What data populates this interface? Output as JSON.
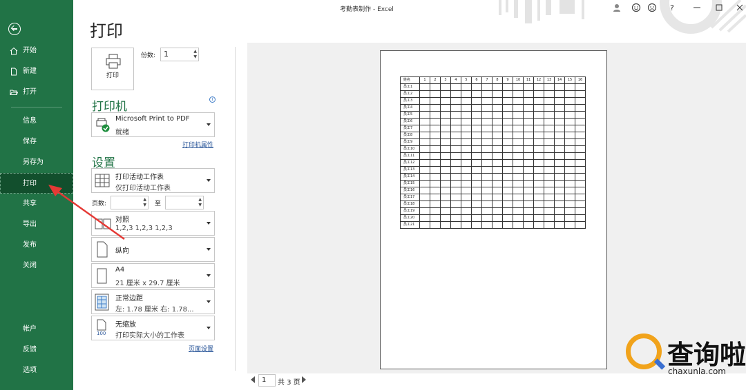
{
  "window": {
    "title": "考勤表制作  -  Excel"
  },
  "sidebar": {
    "items": [
      {
        "label": "开始",
        "icon": "home-icon"
      },
      {
        "label": "新建",
        "icon": "new-doc-icon"
      },
      {
        "label": "打开",
        "icon": "folder-open-icon"
      },
      {
        "label": "信息"
      },
      {
        "label": "保存"
      },
      {
        "label": "另存为"
      },
      {
        "label": "打印",
        "active": true
      },
      {
        "label": "共享"
      },
      {
        "label": "导出"
      },
      {
        "label": "发布"
      },
      {
        "label": "关闭"
      },
      {
        "label": "帐户"
      },
      {
        "label": "反馈"
      },
      {
        "label": "选项"
      }
    ]
  },
  "print": {
    "title": "打印",
    "button_label": "打印",
    "copies_label": "份数:",
    "copies_value": "1",
    "printer_section": "打印机",
    "printer_name": "Microsoft Print to PDF",
    "printer_status": "就绪",
    "printer_props_link": "打印机属性",
    "settings_section": "设置",
    "scope_title": "打印活动工作表",
    "scope_sub": "仅打印活动工作表",
    "pages_label": "页数:",
    "pages_to_label": "至",
    "collate_title": "对照",
    "collate_sub": "1,2,3    1,2,3    1,2,3",
    "orientation": "纵向",
    "paper_title": "A4",
    "paper_sub": "21 厘米 x 29.7 厘米",
    "margins_title": "正常边距",
    "margins_sub": "左: 1.78 厘米    右: 1.78...",
    "scaling_title": "无缩放",
    "scaling_sub": "打印实际大小的工作表",
    "scaling_icon_text": "100",
    "page_setup_link": "页面设置"
  },
  "preview": {
    "header_name": "姓名",
    "day_columns": [
      "1",
      "2",
      "3",
      "4",
      "5",
      "6",
      "7",
      "8",
      "9",
      "10",
      "11",
      "12",
      "13",
      "14",
      "15",
      "16"
    ],
    "rows": [
      "员工1",
      "员工2",
      "员工3",
      "员工4",
      "员工5",
      "员工6",
      "员工7",
      "员工8",
      "员工9",
      "员工10",
      "员工11",
      "员工12",
      "员工13",
      "员工14",
      "员工15",
      "员工16",
      "员工17",
      "员工18",
      "员工19",
      "员工20",
      "员工21"
    ],
    "current_page": "1",
    "total_pages": "共 3 页"
  },
  "watermark": {
    "text": "查询啦",
    "sub": "chaxunla.com"
  },
  "colors": {
    "accent": "#217346",
    "active": "#124f2d",
    "arrow": "#e53935"
  }
}
